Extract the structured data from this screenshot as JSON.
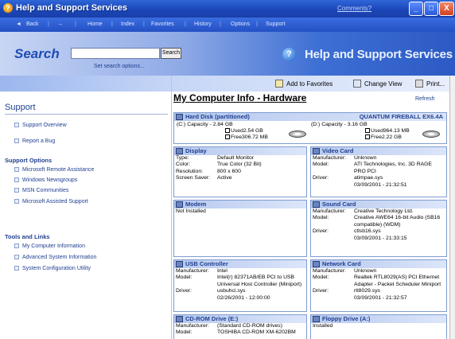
{
  "window": {
    "title": "Help and Support Services",
    "comment_link": "Comments?",
    "minimize_glyph": "_",
    "maximize_glyph": "□",
    "close_glyph": "X"
  },
  "navbar": {
    "back": "Back",
    "forward": "→",
    "home": "Home",
    "index": "Index",
    "favorites": "Favorites",
    "history": "History",
    "options": "Options",
    "support": "Support"
  },
  "search": {
    "label": "Search",
    "input_value": "",
    "button": "Search",
    "options_link": "Set search options..."
  },
  "brand": {
    "title": "Help and Support Services",
    "globe_glyph": "?"
  },
  "sidebar": {
    "heading": "Support",
    "items": [
      "Support Overview",
      "Report a Bug"
    ],
    "support_options_title": "Support Options",
    "support_options": [
      "Microsoft Remote Assistance",
      "Windows Newsgroups",
      "MSN Communities",
      "Microsoft Assisted Support"
    ],
    "tools_title": "Tools and Links",
    "tools": [
      "My Computer Information",
      "Advanced System Information",
      "System Configuration Utility"
    ]
  },
  "toolbar": {
    "add_favorites": "Add to Favorites",
    "change_view": "Change View",
    "print": "Print..."
  },
  "main": {
    "title": "My Computer Info - Hardware",
    "refresh": "Refresh"
  },
  "hard_disk": {
    "title": "Hard Disk (partitioned)",
    "model": "QUANTUM FIREBALL EX6.4A",
    "c": {
      "label": "(C:) Capacity - 2.84 GB",
      "used": "Used2.54 GB",
      "free": "Free306.72 MB"
    },
    "d": {
      "label": "(D:) Capacity - 3.16 GB",
      "used": "Used964.13 MB",
      "free": "Free2.22 GB"
    }
  },
  "display": {
    "title": "Display",
    "rows": [
      {
        "k": "Type:",
        "v": "Default Monitor"
      },
      {
        "k": "Color:",
        "v": "True Color (32 Bit)"
      },
      {
        "k": "Resolution:",
        "v": "800 x 600"
      },
      {
        "k": "Screen Saver:",
        "v": "Active"
      }
    ]
  },
  "video": {
    "title": "Video Card",
    "rows": [
      {
        "k": "Manufacturer:",
        "v": "Unknown"
      },
      {
        "k": "Model:",
        "v": "ATI Technologies, Inc. 3D RAGE PRO PCI"
      },
      {
        "k": "Driver:",
        "v": "atimpae.sys"
      },
      {
        "k": "",
        "v": "03/09/2001 - 21:32:51"
      }
    ]
  },
  "modem": {
    "title": "Modem",
    "status": "Not Installed"
  },
  "sound": {
    "title": "Sound Card",
    "rows": [
      {
        "k": "Manufacturer:",
        "v": "Creative Technology Ltd."
      },
      {
        "k": "Model:",
        "v": "Creative AWE64 16-bit Audio (SB16 compatible) (WDM)"
      },
      {
        "k": "Driver:",
        "v": "ctlsb16.sys"
      },
      {
        "k": "",
        "v": "03/09/2001 - 21:33:15"
      }
    ]
  },
  "usb": {
    "title": "USB Controller",
    "rows": [
      {
        "k": "Manufacturer:",
        "v": "Intel"
      },
      {
        "k": "Model:",
        "v": "Intel(r) 82371AB/EB PCI to USB Universal Host Controller (Miniport)"
      },
      {
        "k": "Driver:",
        "v": "usbuhci.sys"
      },
      {
        "k": "",
        "v": "02/26/2001 - 12:00:00"
      }
    ]
  },
  "network": {
    "title": "Network Card",
    "rows": [
      {
        "k": "Manufacturer:",
        "v": "Unknown"
      },
      {
        "k": "Model:",
        "v": "Realtek RTL8029(AS) PCI Ethernet Adapter - Packet Scheduler Miniport"
      },
      {
        "k": "Driver:",
        "v": "rtl8029.sys"
      },
      {
        "k": "",
        "v": "03/09/2001 - 21:32:57"
      }
    ]
  },
  "cdrom": {
    "title": "CD-ROM Drive  (E:)",
    "rows": [
      {
        "k": "Manufacturer:",
        "v": "(Standard CD-ROM drives)"
      },
      {
        "k": "Model:",
        "v": "TOSHIBA CD-ROM XM-6202BM"
      }
    ]
  },
  "floppy": {
    "title": "Floppy Drive  (A:)",
    "status": "Installed"
  }
}
